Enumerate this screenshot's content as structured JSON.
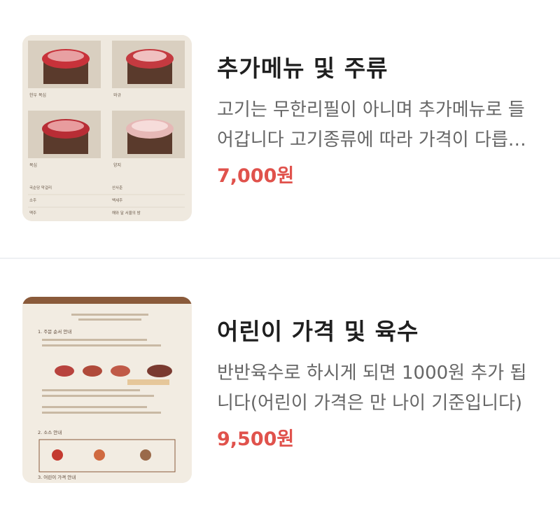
{
  "menu": [
    {
      "title": "추가메뉴 및 주류",
      "description": "고기는 무한리필이 아니며 추가메뉴로 들어갑니다 고기종류에 따라 가격이 다릅니다",
      "price": "7,000원",
      "image_alt": "menu-photo-meat",
      "image_text": {
        "p1": "한우 목심",
        "p2": "와규",
        "p3": "목심",
        "p4": "양지",
        "r1": "국순당 막걸리",
        "r2": "산사춘",
        "r3": "소주",
        "r4": "백세주",
        "r5": "맥주",
        "r6": "해와 달 서울의 밤"
      }
    },
    {
      "title": "어린이 가격 및 육수",
      "description": "반반육수로 하시게 되면 1000원 추가 됩니다(어린이 가격은 만 나이 기준입니다)",
      "price": "9,500원",
      "image_alt": "menu-photo-order-guide",
      "image_text": {
        "s1": "1. 주문 순서 안내",
        "s2": "2. 소스 안내",
        "s3": "3. 어린이 가격 안내"
      }
    }
  ]
}
